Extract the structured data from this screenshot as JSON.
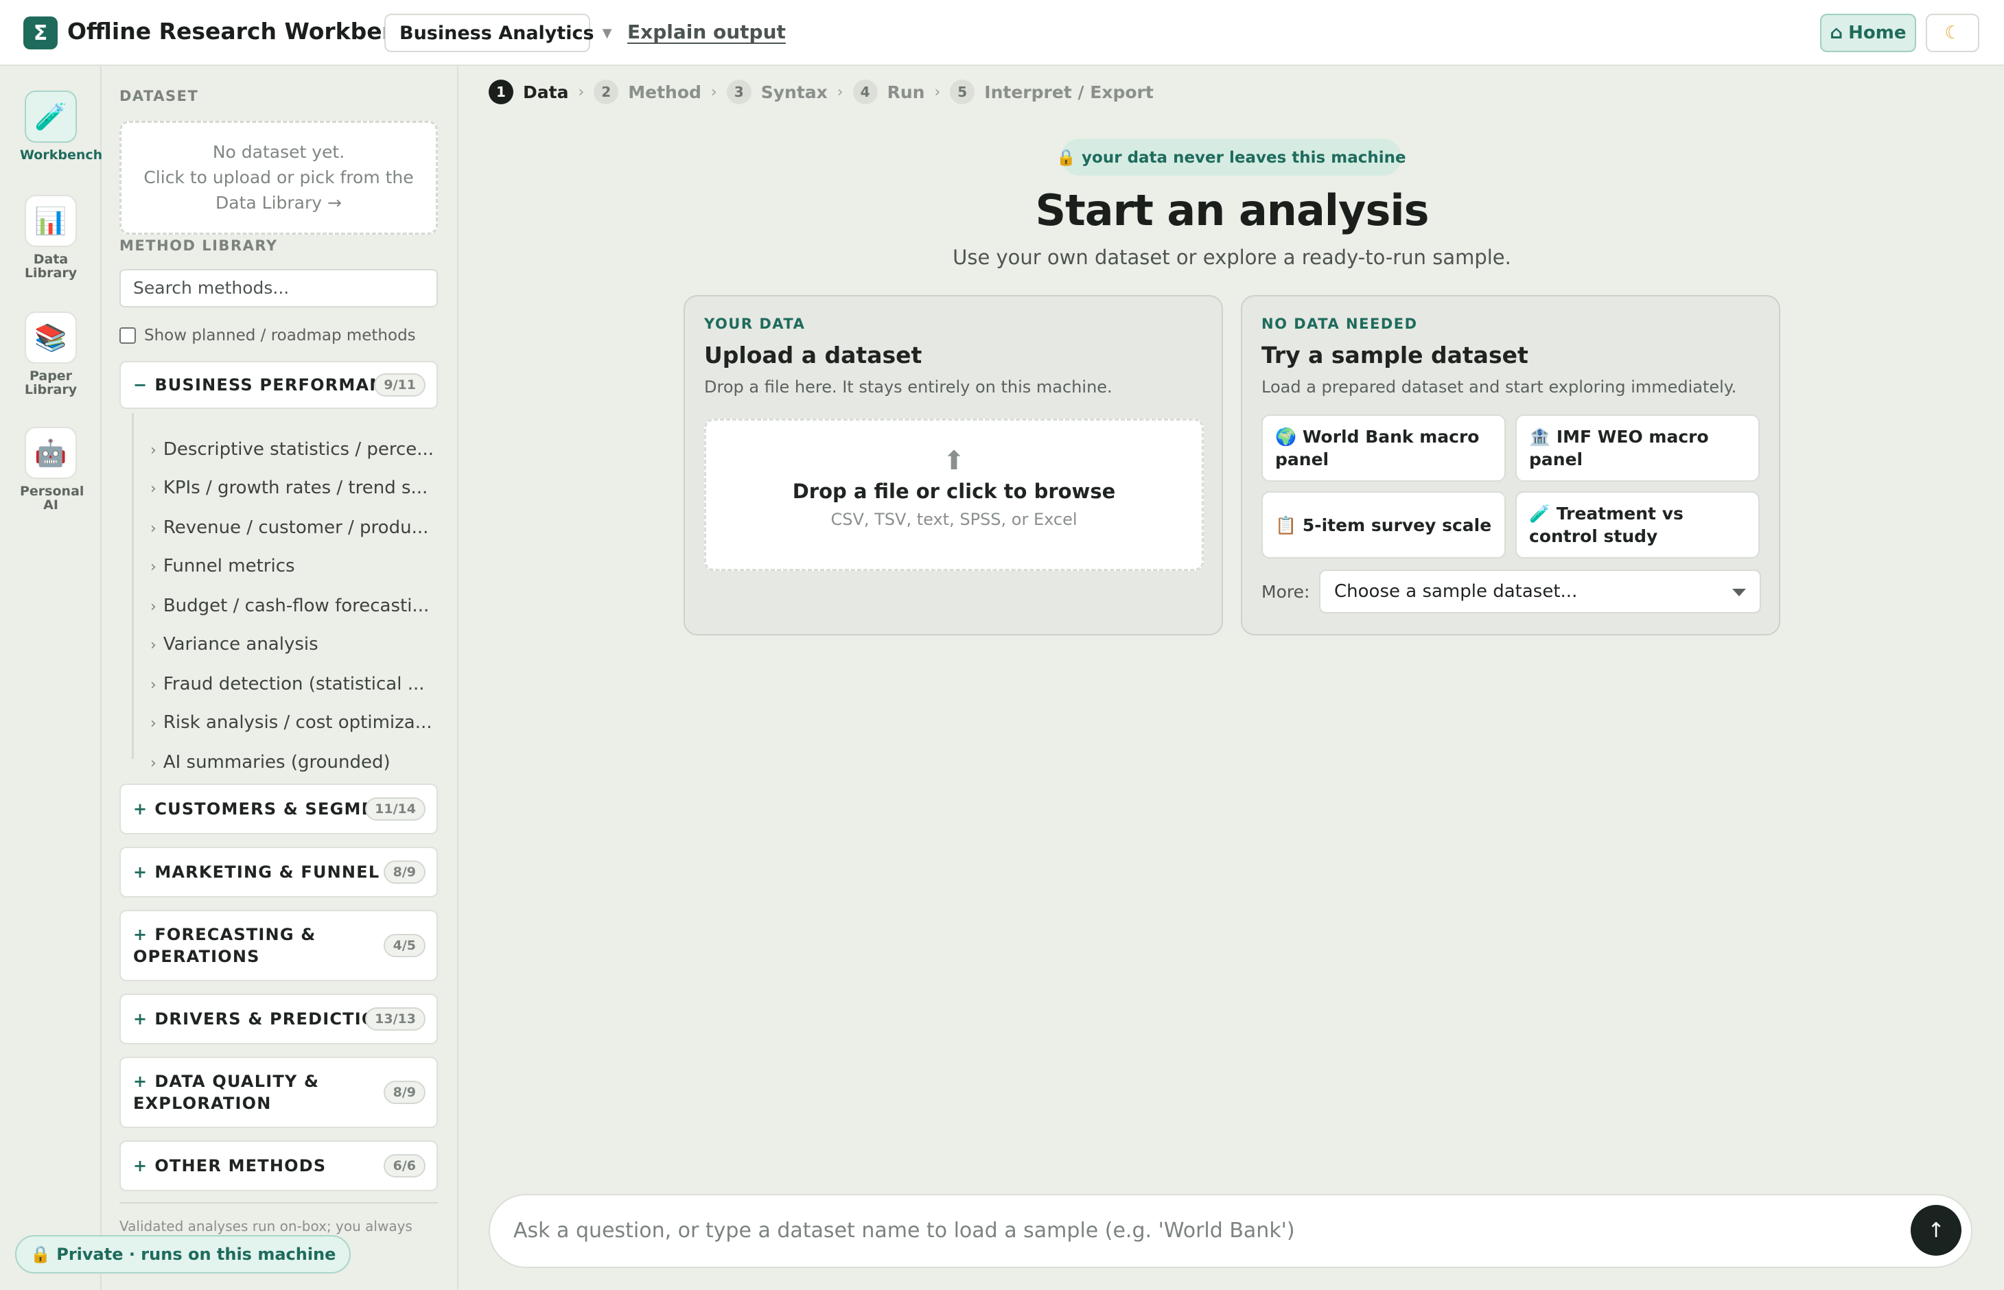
{
  "app": {
    "logo_glyph": "Σ",
    "title": "Offline Research Workbench",
    "mode": "Business Analytics",
    "explain_link": "Explain output",
    "home_icon": "⌂",
    "home_label": "Home",
    "theme_icon": "moon-icon",
    "accent_color": "#1e6b5c"
  },
  "rail": {
    "items": [
      {
        "label": "Workbench",
        "icon": "flask-icon",
        "glyph": "🧪"
      },
      {
        "label": "Data Library",
        "icon": "bar-chart-icon",
        "glyph": "📊"
      },
      {
        "label": "Paper Library",
        "icon": "books-icon",
        "glyph": "📚"
      },
      {
        "label": "Personal AI",
        "icon": "robot-icon",
        "glyph": "🤖"
      }
    ]
  },
  "panel": {
    "dataset_label": "DATASET",
    "dataset_empty_line1": "No dataset yet.",
    "dataset_empty_line2": "Click to upload or pick from the",
    "dataset_empty_line3": "Data Library →",
    "method_library_label": "METHOD LIBRARY",
    "search_placeholder": "Search methods...",
    "planned_toggle": "Show planned / roadmap methods",
    "groups": [
      {
        "sign": "−",
        "title": "BUSINESS PERFORMANCE",
        "count": "9/11"
      },
      {
        "sign": "+",
        "title": "CUSTOMERS & SEGMENTS",
        "count": "11/14"
      },
      {
        "sign": "+",
        "title": "MARKETING & FUNNEL",
        "count": "8/9"
      },
      {
        "sign": "+",
        "title": "FORECASTING & OPERATIONS",
        "count": "4/5"
      },
      {
        "sign": "+",
        "title": "DRIVERS & PREDICTION",
        "count": "13/13"
      },
      {
        "sign": "+",
        "title": "DATA QUALITY & EXPLORATION",
        "count": "8/9"
      },
      {
        "sign": "+",
        "title": "OTHER METHODS",
        "count": "6/6"
      }
    ],
    "methods": [
      "Descriptive statistics / perce...",
      "KPIs / growth rates / trend s...",
      "Revenue / customer / produ...",
      "Funnel metrics",
      "Budget / cash-flow forecasti...",
      "Variance analysis",
      "Fraud detection (statistical ...",
      "Risk analysis / cost optimiza...",
      "AI summaries (grounded)"
    ],
    "footer_note": "Validated analyses run on-box; you always see the code, and every run is",
    "private_pill": "🔒 Private · runs on this machine"
  },
  "steps": [
    {
      "num": "1",
      "label": "Data"
    },
    {
      "num": "2",
      "label": "Method"
    },
    {
      "num": "3",
      "label": "Syntax"
    },
    {
      "num": "4",
      "label": "Run"
    },
    {
      "num": "5",
      "label": "Interpret / Export"
    }
  ],
  "hero": {
    "privacy_chip": "🔒 your data never leaves this machine",
    "title": "Start an analysis",
    "subtitle": "Use your own dataset or explore a ready-to-run sample."
  },
  "upload_card": {
    "kicker": "YOUR DATA",
    "title": "Upload a dataset",
    "desc": "Drop a file here. It stays entirely on this machine.",
    "drop_arrow": "⬆",
    "drop_title": "Drop a file or click to browse",
    "drop_sub": "CSV, TSV, text, SPSS, or Excel"
  },
  "sample_card": {
    "kicker": "NO DATA NEEDED",
    "title": "Try a sample dataset",
    "desc": "Load a prepared dataset and start exploring immediately.",
    "samples": [
      "🌍 World Bank macro panel",
      "🏦 IMF WEO macro panel",
      "📋 5-item survey scale",
      "🧪 Treatment vs control study"
    ],
    "more_label": "More:",
    "more_select": "Choose a sample dataset..."
  },
  "ask": {
    "placeholder": "Ask a question, or type a dataset name to load a sample (e.g. 'World Bank')",
    "send_icon": "↑"
  }
}
